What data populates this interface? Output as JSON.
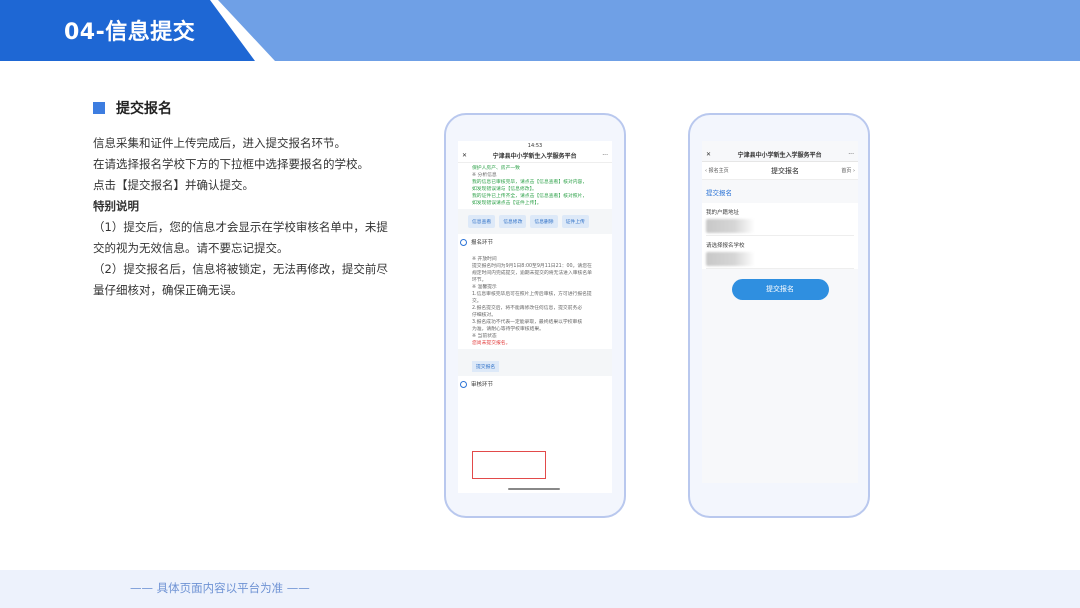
{
  "header": {
    "title": "04-信息提交"
  },
  "section": {
    "title": "提交报名",
    "lines": [
      "信息采集和证件上传完成后，进入提交报名环节。",
      "在请选择报名学校下方的下拉框中选择要报名的学校。",
      "点击【提交报名】并确认提交。",
      "特别说明",
      "（1）提交后，您的信息才会显示在学校审核名单中，未提",
      "交的视为无效信息。请不要忘记提交。",
      "（2）提交报名后，信息将被锁定，无法再修改，提交前尽",
      "量仔细核对，确保正确无误。"
    ]
  },
  "phone1": {
    "time": "14:53",
    "nav_close": "✕",
    "nav_title": "宁津县中小学新生入学服务平台",
    "nav_more": "···",
    "top_green": "保护人房产、房产一致",
    "info_head": "※ 分析信息",
    "green_lines": [
      "我的信息已审核完毕，请点击【信息查看】核对内容，",
      "如发现错误请与【信息修改】。",
      "我的证件已上传齐全，请点击【信息查看】核对照片，",
      "如发现错误请点击【证件上传】。"
    ],
    "buttons": [
      "信息查看",
      "信息修改",
      "信息删除",
      "证件上传"
    ],
    "step_register": "报名环节",
    "notes_head": "※ 开放时间",
    "notes": [
      "提交报名时间为9月1日8:00至9月11日21：00。请您在",
      "规定时间内完成提交，逾期未提交的将无法进入审核名单",
      "环节。",
      "※ 温馨提示",
      "1.信息审核完毕后可在照片上传后审核，方可进行报名提",
      "交。",
      "2.报名提交后，将不能再修改任何信息，提交前务必",
      "仔细核对。",
      "3.报名成功不代表一定能录取，最终结果以学校审核",
      "为准，请耐心等待学校审核结果。",
      "※ 当前状态"
    ],
    "red_line": "您尚未提交报名。",
    "submit_label": "提交报名",
    "step_review": "审核环节"
  },
  "phone2": {
    "nav_close": "✕",
    "nav_title": "宁津县中小学新生入学服务平台",
    "nav_more": "···",
    "back_label": "报名主页",
    "page_title": "提交报名",
    "home_label": "首页",
    "section_label": "提交报名",
    "field1_label": "我的户籍地址",
    "field2_label": "请选择报名学校",
    "submit_button": "提交报名"
  },
  "footer": {
    "note": "—— 具体页面内容以平台为准 ——"
  },
  "colors": {
    "accent": "#1e67d4",
    "band": "#6fa0e6",
    "button": "#2f8fe0",
    "footer_bg": "#edf2fc"
  }
}
